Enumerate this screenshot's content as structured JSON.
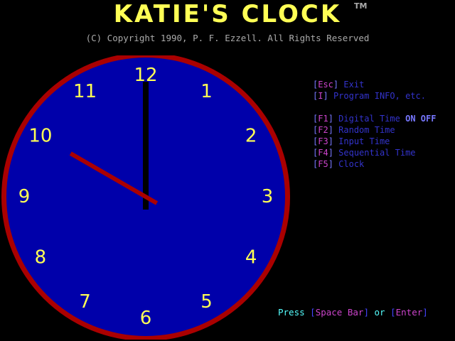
{
  "title": "KATIE'S CLOCK",
  "trademark": "TM",
  "copyright": "(C) Copyright 1990, P. F. Ezzell. All Rights Reserved",
  "clock": {
    "numerals": [
      "12",
      "1",
      "2",
      "3",
      "4",
      "5",
      "6",
      "7",
      "8",
      "9",
      "10",
      "11"
    ],
    "time": {
      "hour": 10,
      "minute": 0
    },
    "colors": {
      "face": "#0000aa",
      "rim": "#aa0000",
      "numerals": "#ffff55",
      "hour_hand": "#aa0000",
      "minute_hand": "#000000"
    }
  },
  "menu": [
    {
      "key": "Esc",
      "label": "Exit"
    },
    {
      "key": "I",
      "label": "Program INFO, etc."
    },
    {
      "key": "F1",
      "label": "Digital Time",
      "on": "ON",
      "off": "OFF"
    },
    {
      "key": "F2",
      "label": "Random Time"
    },
    {
      "key": "F3",
      "label": "Input Time"
    },
    {
      "key": "F4",
      "label": "Sequential Time"
    },
    {
      "key": "F5",
      "label": "Clock"
    }
  ],
  "prompt": {
    "press": "Press",
    "key1": "Space Bar",
    "or": "or",
    "key2": "Enter"
  }
}
